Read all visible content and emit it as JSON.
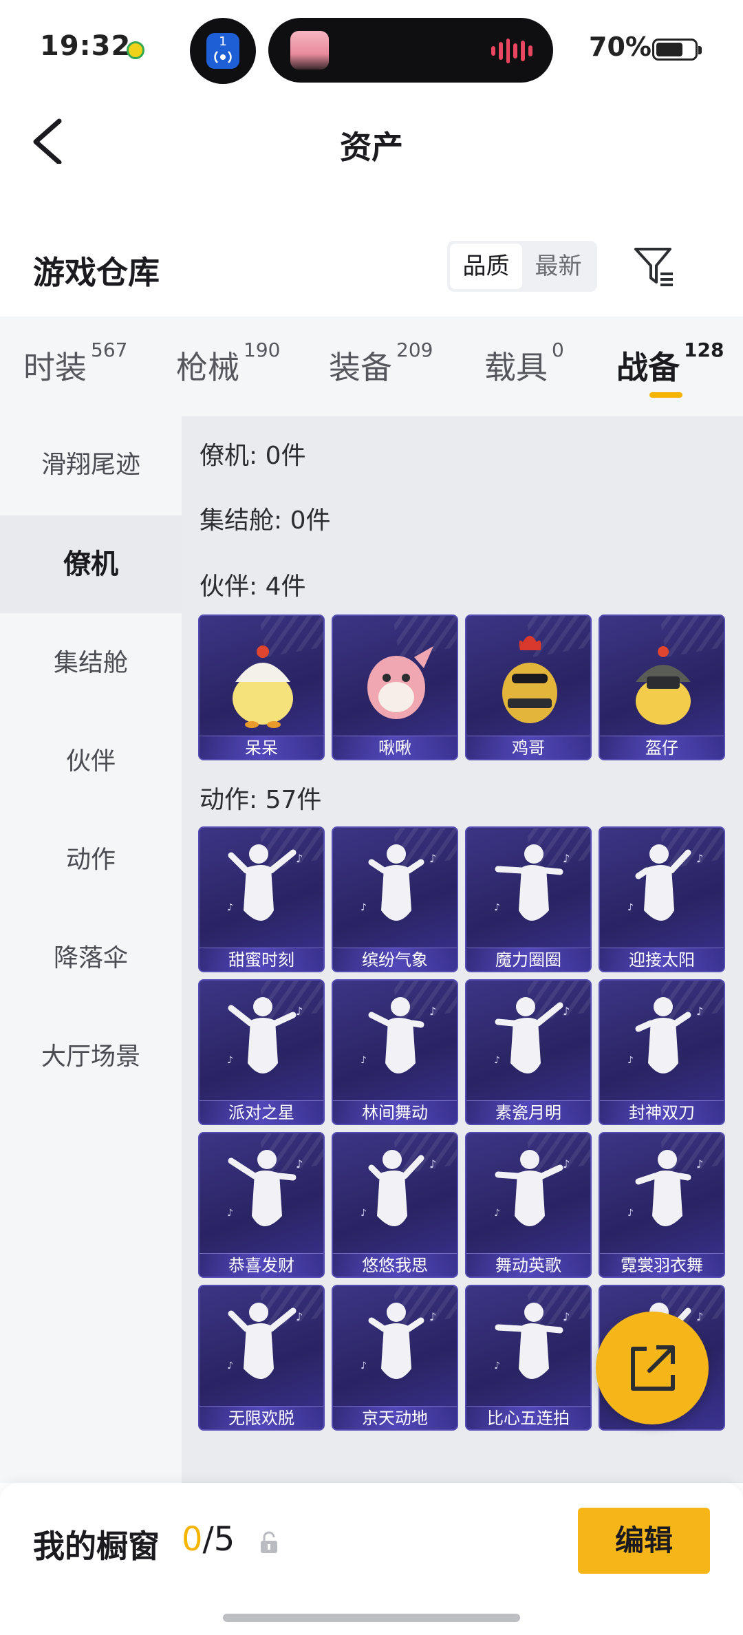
{
  "status_bar": {
    "time": "19:32",
    "battery": "70%",
    "battery_fraction": 0.7,
    "island_badge": "1"
  },
  "nav": {
    "title": "资产"
  },
  "warehouse": {
    "title": "游戏仓库",
    "sort_options": [
      "品质",
      "最新"
    ],
    "active_sort": "品质"
  },
  "tabs": [
    {
      "label": "时装",
      "count": "567"
    },
    {
      "label": "枪械",
      "count": "190"
    },
    {
      "label": "装备",
      "count": "209"
    },
    {
      "label": "载具",
      "count": "0"
    },
    {
      "label": "战备",
      "count": "128",
      "active": true
    }
  ],
  "sidebar": {
    "items": [
      "滑翔尾迹",
      "僚机",
      "集结舱",
      "伙伴",
      "动作",
      "降落伞",
      "大厅场景"
    ],
    "active": "僚机"
  },
  "sections": {
    "wingman": "僚机: 0件",
    "capsule": "集结舱: 0件",
    "partner": "伙伴: 4件",
    "emote": "动作: 57件"
  },
  "partners": [
    "呆呆",
    "啾啾",
    "鸡哥",
    "盔仔"
  ],
  "emotes": [
    "甜蜜时刻",
    "缤纷气象",
    "魔力圈圈",
    "迎接太阳",
    "派对之星",
    "林间舞动",
    "素瓷月明",
    "封神双刀",
    "恭喜发财",
    "悠悠我思",
    "舞动英歌",
    "霓裳羽衣舞",
    "无限欢脱",
    "京天动地",
    "比心五连拍",
    ""
  ],
  "bottom_bar": {
    "label": "我的橱窗",
    "current": "0",
    "total": "/5",
    "edit": "编辑"
  },
  "colors": {
    "accent": "#f6b61a",
    "card_bg": "#2a2463",
    "card_border": "#544bb3"
  },
  "icons": [
    "back-icon",
    "filter-icon",
    "share-icon",
    "lock-icon"
  ]
}
